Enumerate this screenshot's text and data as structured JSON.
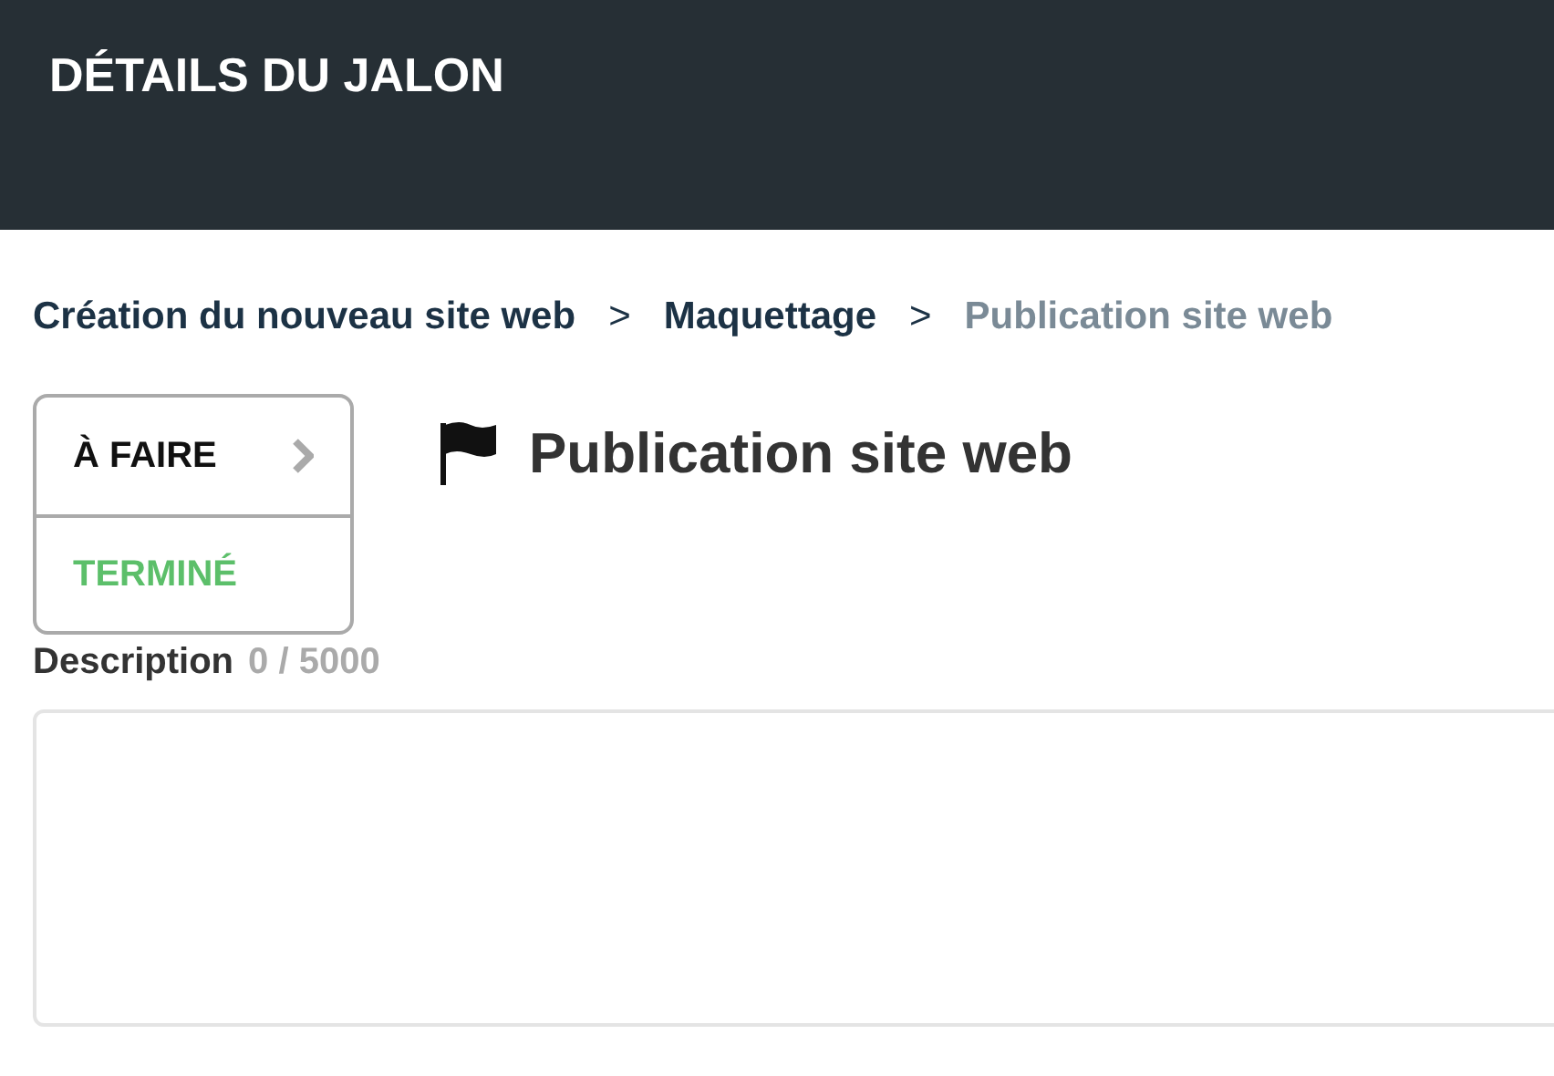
{
  "header": {
    "title": "DÉTAILS DU JALON"
  },
  "breadcrumb": [
    {
      "label": "Création du nouveau site web",
      "current": false
    },
    {
      "label": "Maquettage",
      "current": false
    },
    {
      "label": "Publication site web",
      "current": true
    }
  ],
  "breadcrumb_separators": [
    ">",
    ">"
  ],
  "status_menu": [
    {
      "label": "À FAIRE",
      "selected": true,
      "color": "#111111"
    },
    {
      "label": "TERMINÉ",
      "selected": false,
      "color": "#5cbf6a"
    }
  ],
  "milestone": {
    "title": "Publication site web"
  },
  "description": {
    "label": "Description",
    "counter": "0 / 5000"
  }
}
